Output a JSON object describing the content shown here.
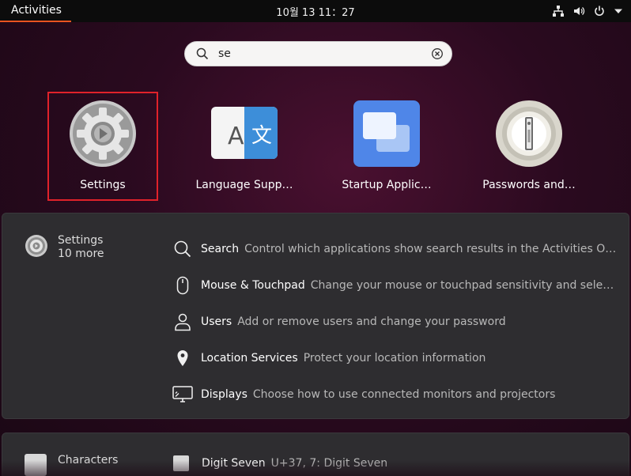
{
  "topbar": {
    "activities_label": "Activities",
    "clock": "10월 13  11：27",
    "tray_icons": [
      "network-icon",
      "volume-icon",
      "power-icon",
      "chevron-down-icon"
    ]
  },
  "search": {
    "value": "se",
    "placeholder": ""
  },
  "apps": [
    {
      "label": "Settings",
      "icon": "settings-gear-icon",
      "selected": true
    },
    {
      "label": "Language Supp…",
      "icon": "language-support-icon",
      "selected": false
    },
    {
      "label": "Startup Applic…",
      "icon": "startup-applications-icon",
      "selected": false
    },
    {
      "label": "Passwords and…",
      "icon": "passwords-keyring-icon",
      "selected": false
    }
  ],
  "results_panel": {
    "provider_name": "Settings",
    "provider_more": "10 more",
    "rows": [
      {
        "icon": "search-icon",
        "title": "Search",
        "desc": "Control which applications show search results in the Activities Over…"
      },
      {
        "icon": "mouse-icon",
        "title": "Mouse & Touchpad",
        "desc": "Change your mouse or touchpad sensitivity and select ri…"
      },
      {
        "icon": "user-icon",
        "title": "Users",
        "desc": "Add or remove users and change your password"
      },
      {
        "icon": "location-pin-icon",
        "title": "Location Services",
        "desc": "Protect your location information"
      },
      {
        "icon": "display-icon",
        "title": "Displays",
        "desc": "Choose how to use connected monitors and projectors"
      }
    ]
  },
  "second_panel": {
    "provider_name": "Characters",
    "row_title": "Digit Seven",
    "row_desc": "U+37, 7: Digit Seven"
  },
  "colors": {
    "accent": "#e95420",
    "selection_outline": "#e0222a",
    "panel_bg": "#2e2d30",
    "topbar_bg": "#0c0c0c"
  }
}
